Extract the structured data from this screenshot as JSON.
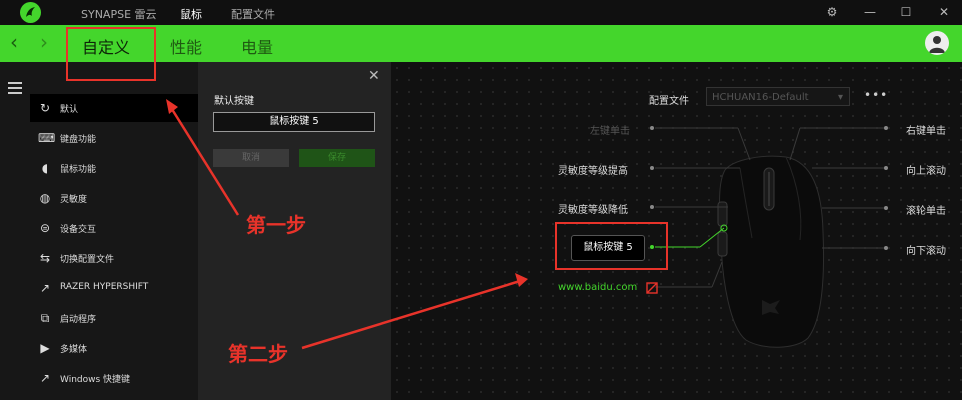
{
  "titlebar": {
    "nav": [
      "SYNAPSE 雷云",
      "鼠标",
      "配置文件"
    ],
    "active_nav": "鼠标",
    "window_buttons": [
      "settings-icon",
      "minimize-icon",
      "maximize-icon",
      "close-icon"
    ]
  },
  "subnav": {
    "tabs": [
      "自定义",
      "性能",
      "电量"
    ],
    "active_tab": "自定义"
  },
  "sidebar": {
    "items": [
      {
        "icon": "refresh-icon",
        "label": "默认"
      },
      {
        "icon": "keyboard-icon",
        "label": "键盘功能"
      },
      {
        "icon": "mouse-icon",
        "label": "鼠标功能"
      },
      {
        "icon": "sensitivity-icon",
        "label": "灵敏度"
      },
      {
        "icon": "interop-icon",
        "label": "设备交互"
      },
      {
        "icon": "switch-profile-icon",
        "label": "切换配置文件"
      },
      {
        "icon": "hypershift-icon",
        "label": "RAZER HYPERSHIFT"
      },
      {
        "icon": "launch-program-icon",
        "label": "启动程序"
      },
      {
        "icon": "multimedia-icon",
        "label": "多媒体"
      },
      {
        "icon": "shortcut-icon",
        "label": "Windows 快捷键"
      }
    ]
  },
  "panel": {
    "title": "默认按键",
    "value": "鼠标按键 5",
    "cancel_label": "取消",
    "save_label": "保存"
  },
  "canvas": {
    "profile_label": "配置文件",
    "profile_value": "HCHUAN16-Default",
    "more": "•••",
    "left_buttons": [
      "左键单击",
      "灵敏度等级提高",
      "灵敏度等级降低",
      "鼠标按键 5",
      "www.baidu.com"
    ],
    "right_buttons": [
      "右键单击",
      "向上滚动",
      "滚轮单击",
      "向下滚动"
    ]
  },
  "annotations": {
    "step1": "第一步",
    "step2": "第二步"
  },
  "colors": {
    "accent": "#44d62c",
    "annotation": "#e8332a"
  }
}
